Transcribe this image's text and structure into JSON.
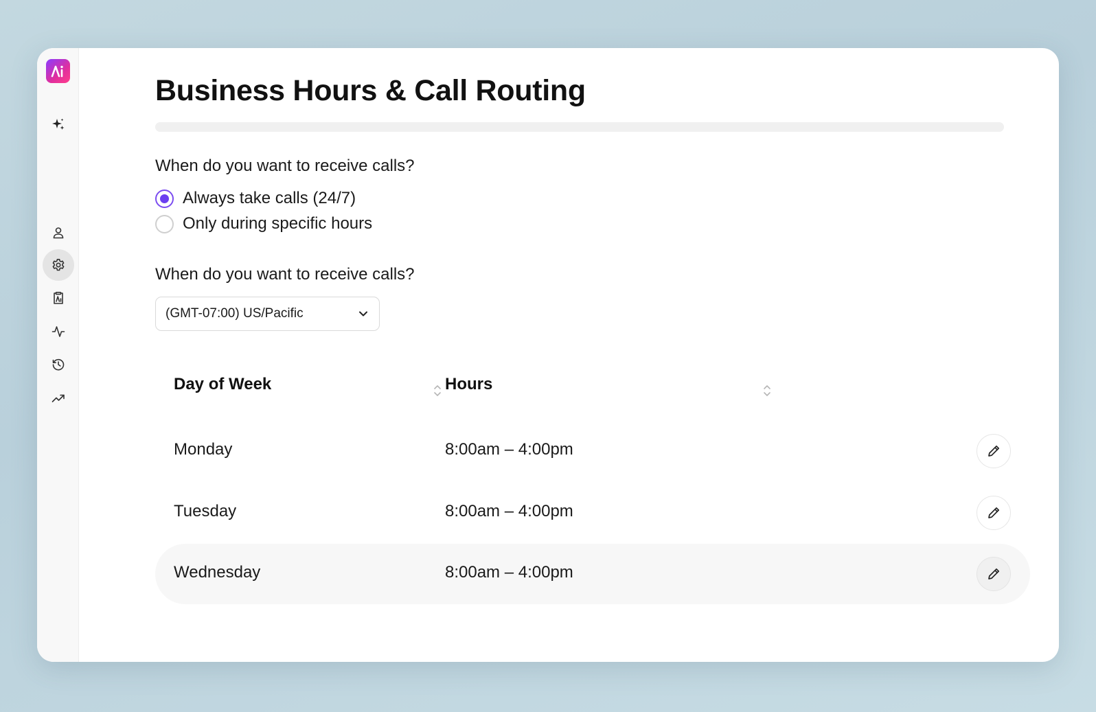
{
  "page": {
    "title": "Business Hours & Call Routing"
  },
  "question1": {
    "label": "When do you want to receive calls?",
    "options": [
      {
        "label": "Always take calls (24/7)",
        "checked": true
      },
      {
        "label": "Only during specific hours",
        "checked": false
      }
    ]
  },
  "question2": {
    "label": "When do you want to receive calls?",
    "timezone": "(GMT-07:00) US/Pacific"
  },
  "table": {
    "headers": [
      "Day of Week",
      "Hours"
    ],
    "rows": [
      {
        "day": "Monday",
        "hours": "8:00am – 4:00pm"
      },
      {
        "day": "Tuesday",
        "hours": "8:00am – 4:00pm"
      },
      {
        "day": "Wednesday",
        "hours": "8:00am – 4:00pm"
      }
    ]
  },
  "sidebar": {
    "items": [
      "sparkles-icon",
      "user-icon",
      "gear-icon",
      "clipboard-icon",
      "activity-icon",
      "history-icon",
      "trending-up-icon"
    ],
    "active": "gear-icon"
  },
  "colors": {
    "accent": "#6c3ff0",
    "logo_start": "#8b3dff",
    "logo_end": "#ff3d8b"
  }
}
